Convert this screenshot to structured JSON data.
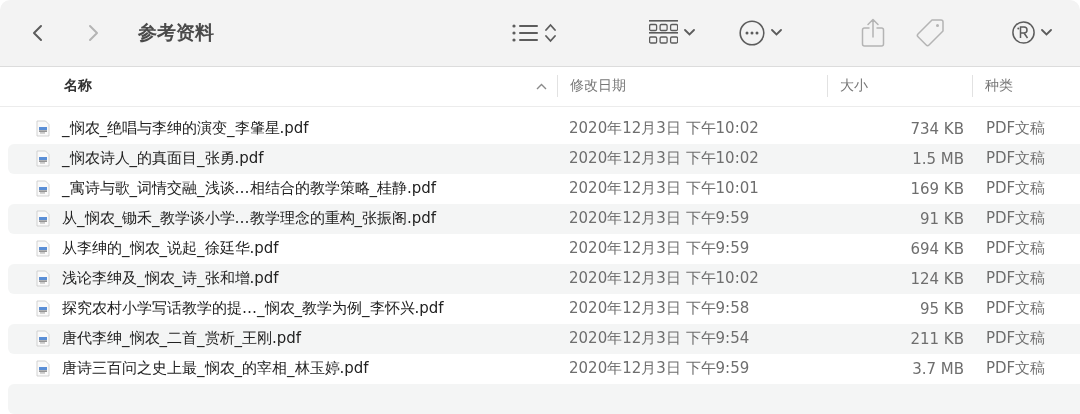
{
  "window": {
    "title": "参考资料"
  },
  "toolbar": [
    {
      "kind": "back",
      "disabled": false
    },
    {
      "kind": "forward",
      "disabled": true
    },
    {
      "kind": "list-view",
      "disabled": false
    },
    {
      "kind": "group",
      "disabled": false
    },
    {
      "kind": "more",
      "disabled": false
    },
    {
      "kind": "share",
      "disabled": true
    },
    {
      "kind": "tag",
      "disabled": true
    },
    {
      "kind": "extension",
      "disabled": false
    }
  ],
  "table": {
    "columns": [
      {
        "label": "名称",
        "sorted": true
      },
      {
        "label": "修改日期",
        "sorted": false
      },
      {
        "label": "大小",
        "sorted": false
      },
      {
        "label": "种类",
        "sorted": false
      }
    ],
    "rows": [
      {
        "name": "_悯农_绝唱与李绅的演变_李肇星.pdf",
        "modified": "2020年12月3日 下午10:02",
        "size": "734 KB",
        "kind": "PDF文稿"
      },
      {
        "name": "_悯农诗人_的真面目_张勇.pdf",
        "modified": "2020年12月3日 下午10:02",
        "size": "1.5 MB",
        "kind": "PDF文稿"
      },
      {
        "name": "_寓诗与歌_词情交融_浅谈…相结合的教学策略_桂静.pdf",
        "modified": "2020年12月3日 下午10:01",
        "size": "169 KB",
        "kind": "PDF文稿"
      },
      {
        "name": "从_悯农_锄禾_教学谈小学…教学理念的重构_张振阁.pdf",
        "modified": "2020年12月3日 下午9:59",
        "size": "91 KB",
        "kind": "PDF文稿"
      },
      {
        "name": "从李绅的_悯农_说起_徐廷华.pdf",
        "modified": "2020年12月3日 下午9:59",
        "size": "694 KB",
        "kind": "PDF文稿"
      },
      {
        "name": "浅论李绅及_悯农_诗_张和增.pdf",
        "modified": "2020年12月3日 下午10:02",
        "size": "124 KB",
        "kind": "PDF文稿"
      },
      {
        "name": "探究农村小学写话教学的提…_悯农_教学为例_李怀兴.pdf",
        "modified": "2020年12月3日 下午9:58",
        "size": "95 KB",
        "kind": "PDF文稿"
      },
      {
        "name": "唐代李绅_悯农_二首_赏析_王刚.pdf",
        "modified": "2020年12月3日 下午9:54",
        "size": "211 KB",
        "kind": "PDF文稿"
      },
      {
        "name": "唐诗三百问之史上最_悯农_的宰相_林玉婷.pdf",
        "modified": "2020年12月3日 下午9:59",
        "size": "3.7 MB",
        "kind": "PDF文稿"
      }
    ]
  }
}
